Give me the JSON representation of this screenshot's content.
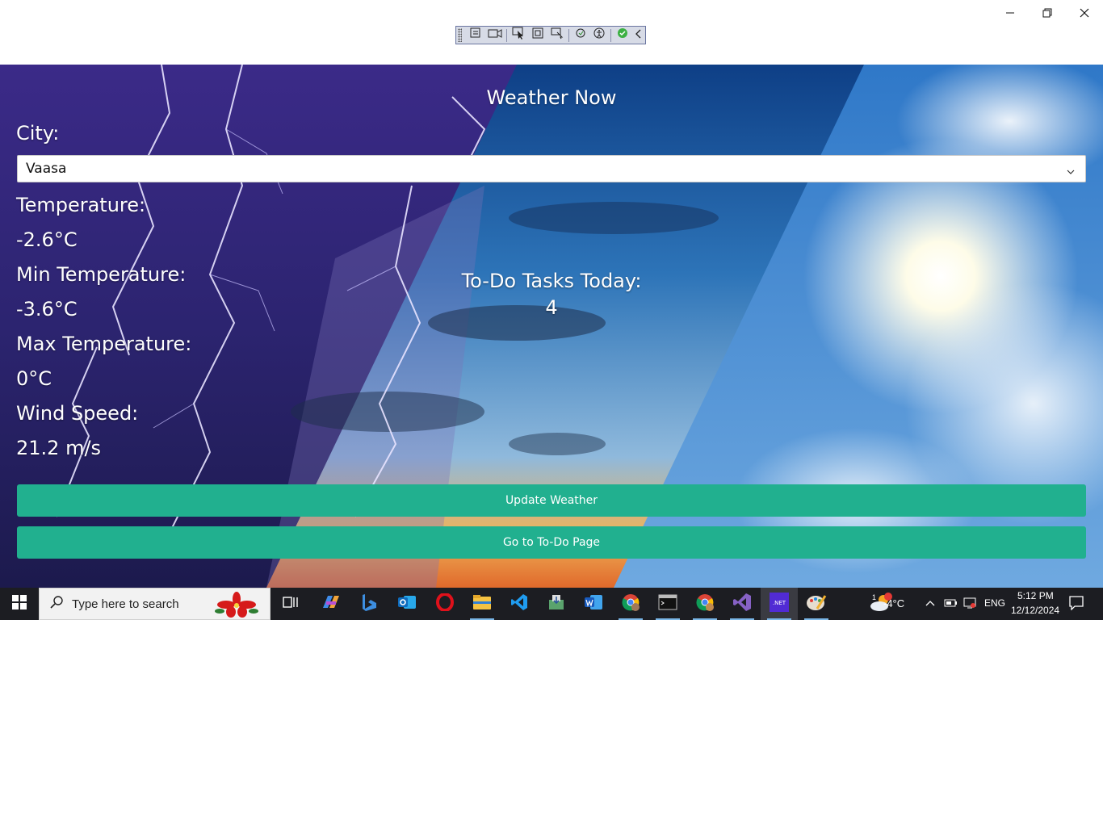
{
  "window": {
    "controls": [
      "minimize-icon",
      "restore-icon",
      "close-icon"
    ]
  },
  "devtools": {
    "icons": [
      "select-element-icon",
      "video-icon",
      "pointer-select-icon",
      "layout-bounds-icon",
      "track-focus-icon",
      "hot-reload-icon",
      "accessibility-icon",
      "check-icon",
      "collapse-chevron-icon"
    ]
  },
  "app": {
    "title": "Weather Now",
    "city_label": "City:",
    "city_value": "Vaasa",
    "temperature_label": "Temperature:",
    "temperature_value": "-2.6°C",
    "min_label": "Min Temperature:",
    "min_value": "-3.6°C",
    "max_label": "Max Temperature:",
    "max_value": "0°C",
    "wind_label": "Wind Speed:",
    "wind_value": "21.2 m/s",
    "todo_label": "To-Do Tasks Today:",
    "todo_count": "4",
    "update_button": "Update Weather",
    "todo_button": "Go to To-Do Page",
    "accent_color": "#21b08f"
  },
  "taskbar": {
    "search_placeholder": "Type here to search",
    "apps": [
      "task-view-icon",
      "copilot-icon",
      "bing-icon",
      "outlook-icon",
      "opera-icon",
      "file-explorer-icon",
      "vscode-icon",
      "app-installer-icon",
      "word-icon",
      "chrome-icon",
      "terminal-icon",
      "chrome-profile-icon",
      "visual-studio-icon",
      "dotnet-icon",
      "paint-icon"
    ],
    "weather_temp": "-4°C",
    "weather_badge": "1",
    "language": "ENG",
    "time": "5:12 PM",
    "date": "12/12/2024"
  }
}
